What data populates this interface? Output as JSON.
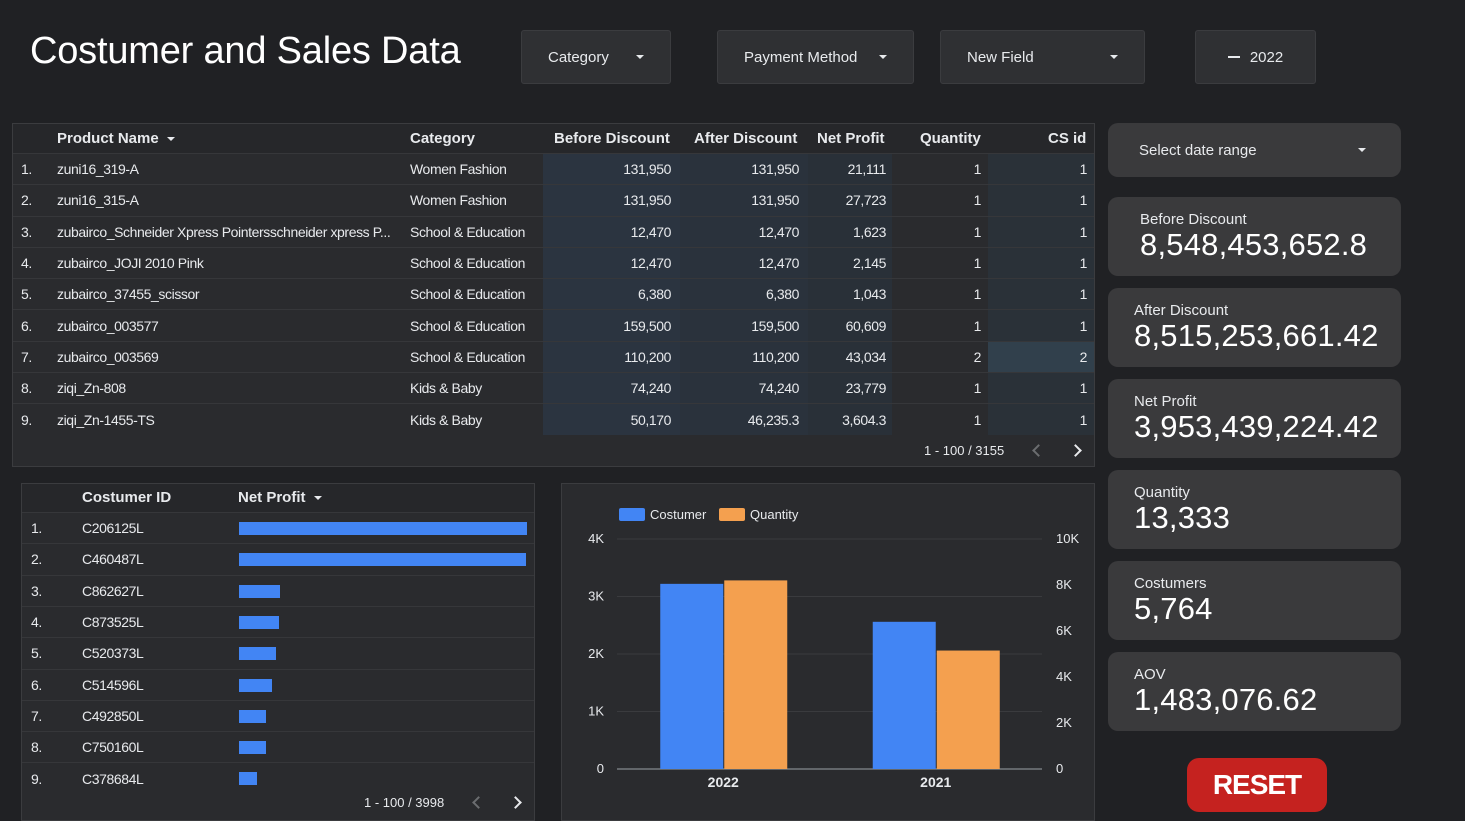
{
  "title": "Costumer and Sales Data",
  "filters": {
    "category": "Category",
    "payment_method": "Payment Method",
    "new_field": "New Field",
    "year": "2022"
  },
  "main_table": {
    "headers": [
      "Product Name",
      "Category",
      "Before Discount",
      "After Discount",
      "Net Profit",
      "Quantity",
      "CS id"
    ],
    "rows": [
      [
        "1.",
        "zuni16_319-A",
        "Women Fashion",
        "131,950",
        "131,950",
        "21,111",
        "1",
        "1"
      ],
      [
        "2.",
        "zuni16_315-A",
        "Women Fashion",
        "131,950",
        "131,950",
        "27,723",
        "1",
        "1"
      ],
      [
        "3.",
        "zubairco_Schneider Xpress Pointersschneider xpress P...",
        "School & Education",
        "12,470",
        "12,470",
        "1,623",
        "1",
        "1"
      ],
      [
        "4.",
        "zubairco_JOJI 2010 Pink",
        "School & Education",
        "12,470",
        "12,470",
        "2,145",
        "1",
        "1"
      ],
      [
        "5.",
        "zubairco_37455_scissor",
        "School & Education",
        "6,380",
        "6,380",
        "1,043",
        "1",
        "1"
      ],
      [
        "6.",
        "zubairco_003577",
        "School & Education",
        "159,500",
        "159,500",
        "60,609",
        "1",
        "1"
      ],
      [
        "7.",
        "zubairco_003569",
        "School & Education",
        "110,200",
        "110,200",
        "43,034",
        "2",
        "2"
      ],
      [
        "8.",
        "ziqi_Zn-808",
        "Kids & Baby",
        "74,240",
        "74,240",
        "23,779",
        "1",
        "1"
      ],
      [
        "9.",
        "ziqi_Zn-1455-TS",
        "Kids & Baby",
        "50,170",
        "46,235.3",
        "3,604.3",
        "1",
        "1"
      ]
    ],
    "pager": "1 - 100 / 3155"
  },
  "customer_table": {
    "headers": [
      "Costumer ID",
      "Net Profit"
    ],
    "rows": [
      {
        "n": "1.",
        "id": "C206125L",
        "share": 1.0
      },
      {
        "n": "2.",
        "id": "C460487L",
        "share": 0.995
      },
      {
        "n": "3.",
        "id": "C862627L",
        "share": 0.142
      },
      {
        "n": "4.",
        "id": "C873525L",
        "share": 0.138
      },
      {
        "n": "5.",
        "id": "C520373L",
        "share": 0.128
      },
      {
        "n": "6.",
        "id": "C514596L",
        "share": 0.114
      },
      {
        "n": "7.",
        "id": "C492850L",
        "share": 0.093
      },
      {
        "n": "8.",
        "id": "C750160L",
        "share": 0.093
      },
      {
        "n": "9.",
        "id": "C378684L",
        "share": 0.062
      }
    ],
    "pager": "1 - 100 / 3998"
  },
  "chart_data": {
    "type": "bar",
    "categories": [
      "2022",
      "2021"
    ],
    "series": [
      {
        "name": "Costumer",
        "axis": "left",
        "color": "#4285f4",
        "values": [
          3220,
          2560
        ]
      },
      {
        "name": "Quantity",
        "axis": "right",
        "color": "#f4a04f",
        "values": [
          8200,
          5150
        ]
      }
    ],
    "y_left": {
      "ticks": [
        "0",
        "1K",
        "2K",
        "3K",
        "4K"
      ],
      "max": 4000
    },
    "y_right": {
      "ticks": [
        "0",
        "2K",
        "4K",
        "6K",
        "8K",
        "10K"
      ],
      "max": 10000
    },
    "legend": "top-left"
  },
  "date_range": "Select date range",
  "kpis": [
    {
      "label": "Before Discount",
      "value": "8,548,453,652.8"
    },
    {
      "label": "After Discount",
      "value": "8,515,253,661.42"
    },
    {
      "label": "Net Profit",
      "value": "3,953,439,224.42"
    },
    {
      "label": "Quantity",
      "value": "13,333"
    },
    {
      "label": "Costumers",
      "value": "5,764"
    },
    {
      "label": "AOV",
      "value": "1,483,076.62"
    }
  ],
  "reset_label": "RESET",
  "colors": {
    "accent_blue": "#4285f4",
    "accent_orange": "#f4a04f",
    "reset_red": "#c5221f"
  }
}
